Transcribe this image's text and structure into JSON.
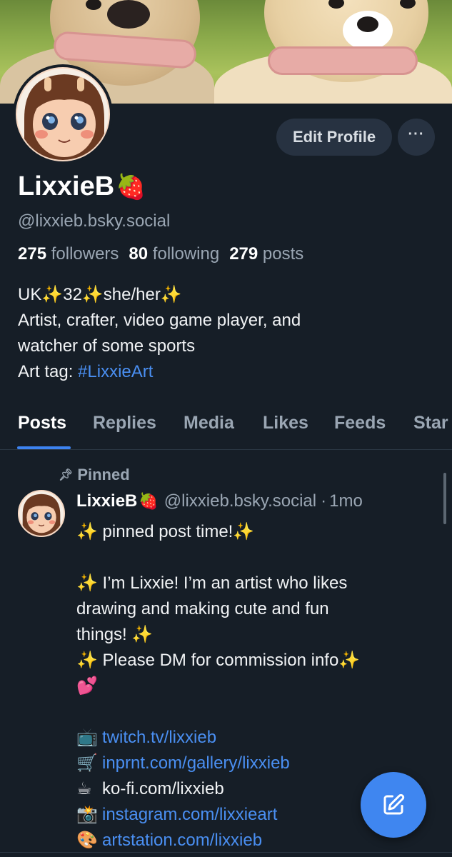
{
  "profile": {
    "display_name": "LixxieB",
    "display_name_emoji": "🍓",
    "handle": "@lixxieb.bsky.social",
    "followers_count": "275",
    "followers_label": "followers",
    "following_count": "80",
    "following_label": "following",
    "posts_count": "279",
    "posts_label": "posts",
    "bio": {
      "line1": "UK✨32✨she/her✨",
      "line2": "Artist, crafter, video game player, and",
      "line3": "watcher of some sports",
      "tag_prefix": "Art tag: ",
      "tag": "#LixxieArt"
    }
  },
  "actions": {
    "edit_profile": "Edit Profile",
    "more": "···"
  },
  "tabs": [
    {
      "label": "Posts",
      "active": true
    },
    {
      "label": "Replies",
      "active": false
    },
    {
      "label": "Media",
      "active": false
    },
    {
      "label": "Likes",
      "active": false
    },
    {
      "label": "Feeds",
      "active": false
    },
    {
      "label": "Star",
      "active": false
    }
  ],
  "post": {
    "pinned_label": "Pinned",
    "author_name": "LixxieB",
    "author_emoji": "🍓",
    "author_handle": "@lixxieb.bsky.social",
    "separator": "·",
    "age": "1mo",
    "lines": {
      "l1": "✨ pinned post time!✨",
      "l2": "✨ I’m Lixxie! I’m an artist who likes",
      "l3": "drawing and making cute and fun",
      "l4": "things! ✨",
      "l5": "✨ Please DM for commission info✨",
      "l6": "💕"
    },
    "links": [
      {
        "emoji": "📺",
        "text": "twitch.tv/lixxieb",
        "is_link": true
      },
      {
        "emoji": "🛒",
        "text": "inprnt.com/gallery/lixxieb",
        "is_link": true
      },
      {
        "emoji": "☕",
        "text": "ko-fi.com/lixxieb",
        "is_link": false
      },
      {
        "emoji": "📸",
        "text": "instagram.com/lixxieart",
        "is_link": true
      },
      {
        "emoji": "🎨",
        "text": "artstation.com/lixxieb",
        "is_link": true
      }
    ]
  },
  "colors": {
    "background": "#161e27",
    "accent": "#3f86f0",
    "link": "#4a8ff2",
    "muted_text": "#9aa6b3"
  },
  "icons": {
    "pin": "pin-icon",
    "compose": "compose-icon"
  }
}
